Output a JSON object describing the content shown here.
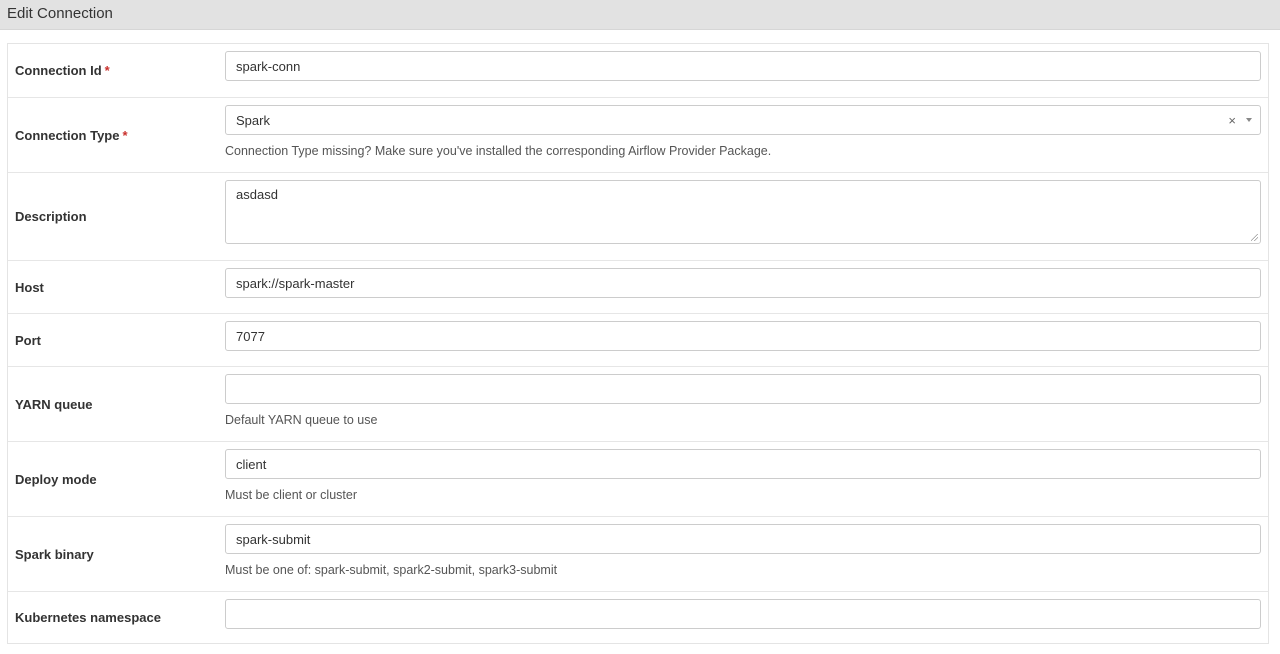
{
  "header": {
    "title": "Edit Connection"
  },
  "required_marker": "*",
  "fields": {
    "conn_id": {
      "label": "Connection Id",
      "value": "spark-conn"
    },
    "conn_type": {
      "label": "Connection Type",
      "value": "Spark",
      "help": "Connection Type missing? Make sure you've installed the corresponding Airflow Provider Package."
    },
    "description": {
      "label": "Description",
      "value": "asdasd"
    },
    "host": {
      "label": "Host",
      "value": "spark://spark-master"
    },
    "port": {
      "label": "Port",
      "value": "7077"
    },
    "yarn_queue": {
      "label": "YARN queue",
      "value": "",
      "help": "Default YARN queue to use"
    },
    "deploy_mode": {
      "label": "Deploy mode",
      "value": "client",
      "help": "Must be client or cluster"
    },
    "spark_binary": {
      "label": "Spark binary",
      "value": "spark-submit",
      "help": "Must be one of: spark-submit, spark2-submit, spark3-submit"
    },
    "k8s_namespace": {
      "label": "Kubernetes namespace",
      "value": ""
    }
  },
  "icons": {
    "clear": "×",
    "dropdown": "chevron-down-icon"
  }
}
